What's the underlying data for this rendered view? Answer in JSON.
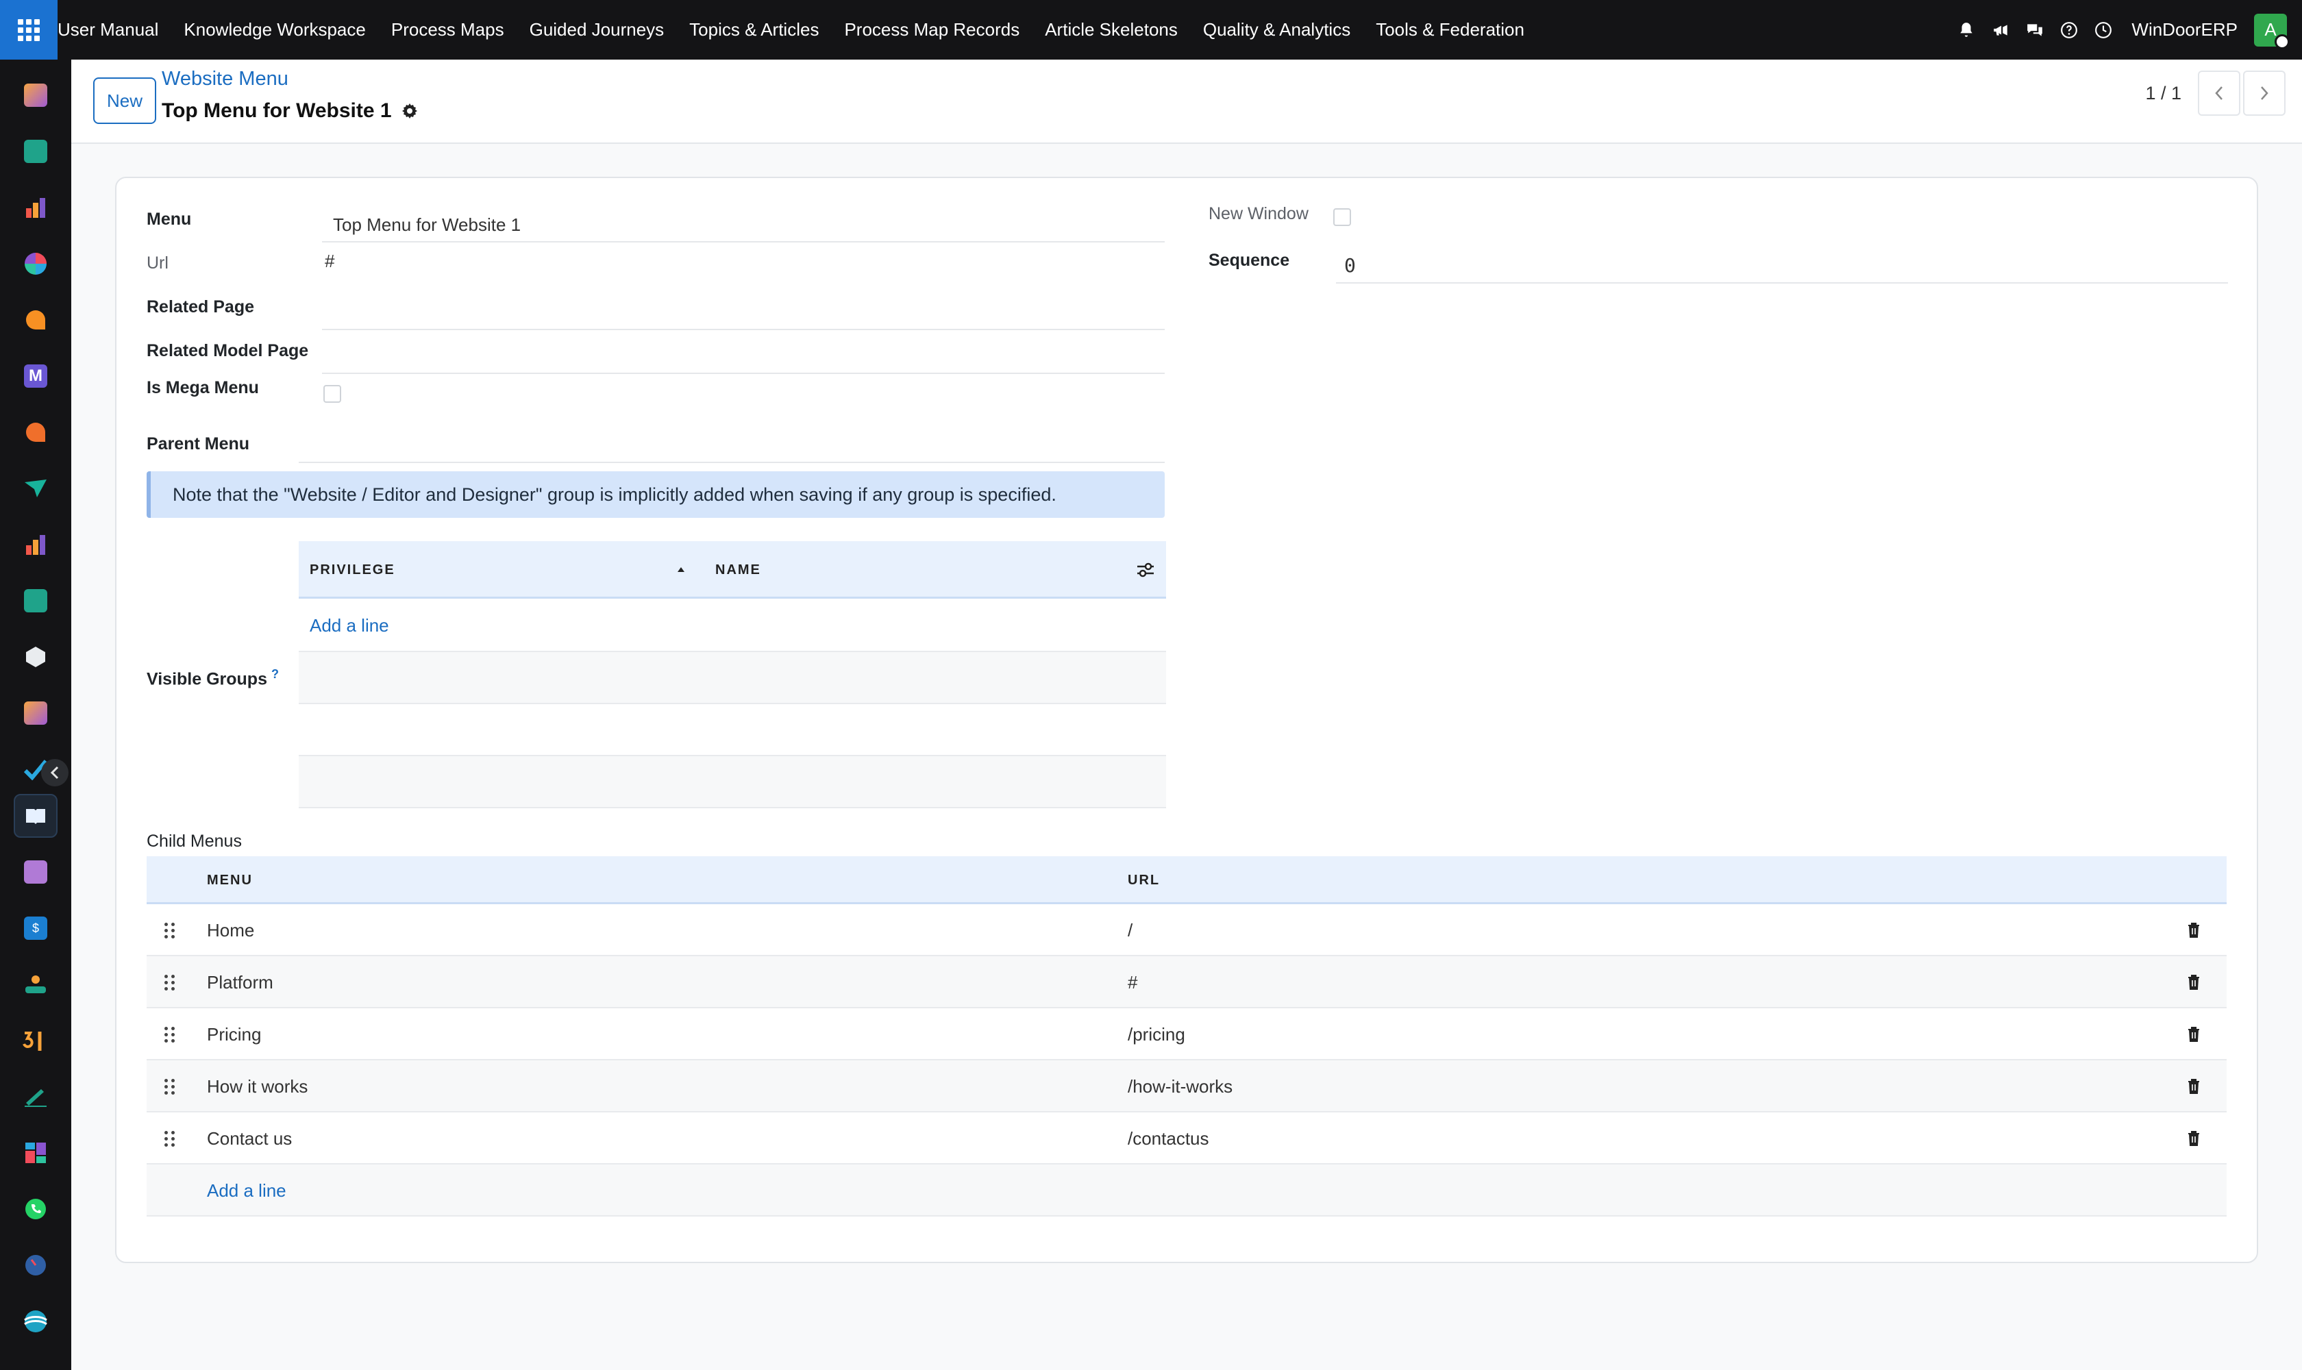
{
  "topbar": {
    "menu": [
      "User Manual",
      "Knowledge Workspace",
      "Process Maps",
      "Guided Journeys",
      "Topics & Articles",
      "Process Map Records",
      "Article Skeletons",
      "Quality & Analytics",
      "Tools & Federation"
    ],
    "company": "WinDoorERP",
    "avatar_initial": "A"
  },
  "control_panel": {
    "new_label": "New",
    "breadcrumb": "Website Menu",
    "record_title": "Top Menu for Website 1",
    "pager": "1 / 1"
  },
  "form": {
    "menu_label": "Menu",
    "menu_value": "Top Menu for Website 1",
    "url_label": "Url",
    "url_value": "#",
    "related_page_label": "Related Page",
    "related_page_value": "",
    "related_model_label": "Related Model Page",
    "related_model_value": "",
    "mega_label": "Is Mega Menu",
    "parent_label": "Parent Menu",
    "parent_value": "",
    "new_window_label": "New Window",
    "sequence_label": "Sequence",
    "sequence_value": "0",
    "note": "Note that the \"Website / Editor and Designer\" group is implicitly added when saving if any group is specified.",
    "visible_groups_label": "Visible Groups",
    "help_mark": "?"
  },
  "groups_table": {
    "col_privilege": "PRIVILEGE",
    "col_name": "NAME",
    "add_line": "Add a line"
  },
  "child_menus": {
    "label": "Child Menus",
    "col_menu": "MENU",
    "col_url": "URL",
    "rows": [
      {
        "menu": "Home",
        "url": "/"
      },
      {
        "menu": "Platform",
        "url": "#"
      },
      {
        "menu": "Pricing",
        "url": "/pricing"
      },
      {
        "menu": "How it works",
        "url": "/how-it-works"
      },
      {
        "menu": "Contact us",
        "url": "/contactus"
      }
    ],
    "add_line": "Add a line"
  }
}
